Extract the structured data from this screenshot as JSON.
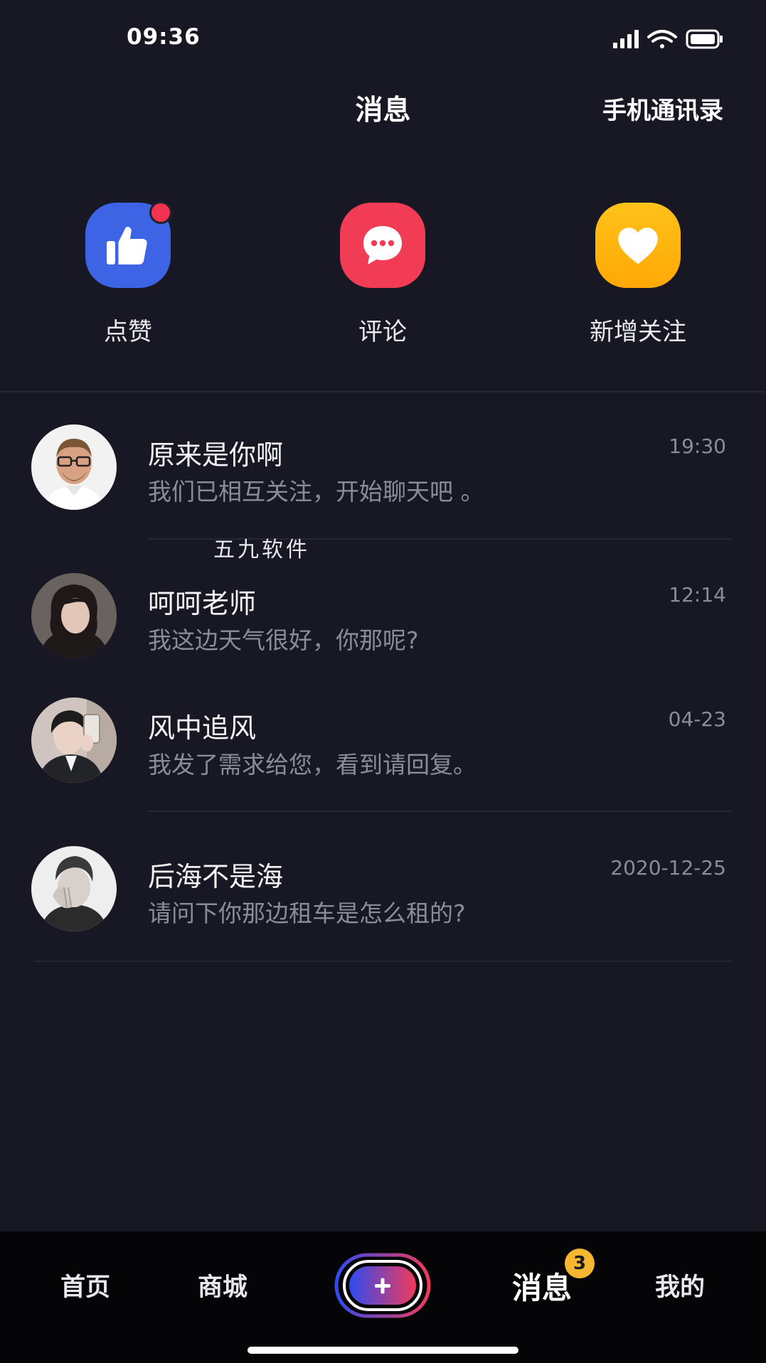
{
  "status_bar": {
    "time": "09:36",
    "icons": [
      "signal-icon",
      "wifi-icon",
      "battery-icon"
    ]
  },
  "header": {
    "title": "消息",
    "contacts_link": "手机通讯录"
  },
  "quick_actions": [
    {
      "label": "点赞",
      "icon": "thumbs-up-icon",
      "color": "#3e64e6",
      "has_dot": true
    },
    {
      "label": "评论",
      "icon": "comment-icon",
      "color": "#f23b55"
    },
    {
      "label": "新增关注",
      "icon": "heart-icon",
      "color": "#ffb60f"
    }
  ],
  "messages": [
    {
      "name": "原来是你啊",
      "preview": "我们已相互关注，开始聊天吧 。",
      "time": "19:30"
    },
    {
      "name": "呵呵老师",
      "preview": "我这边天气很好，你那呢?",
      "time": "12:14"
    },
    {
      "name": "风中追风",
      "preview": "我发了需求给您，看到请回复。",
      "time": "04-23"
    },
    {
      "name": "后海不是海",
      "preview": "请问下你那边租车是怎么租的?",
      "time": "2020-12-25"
    }
  ],
  "watermark": "五九软件",
  "tabbar": {
    "tabs": [
      "首页",
      "商城",
      "消息",
      "我的"
    ],
    "active": "消息",
    "badge": "3"
  }
}
